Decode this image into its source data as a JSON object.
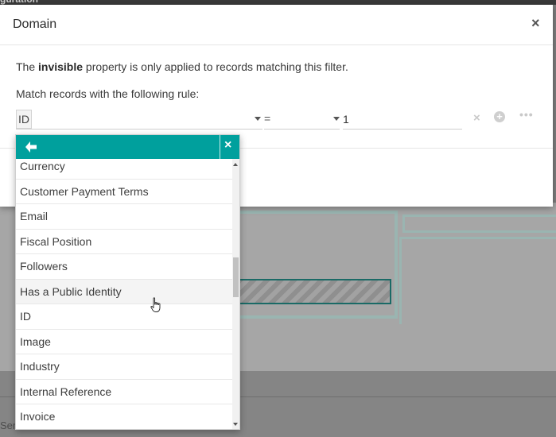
{
  "modal": {
    "title": "Domain",
    "close_symbol": "×",
    "info": {
      "before": "The ",
      "property": "invisible",
      "after": " property is only applied to records matching this filter."
    },
    "rule_label": "Match records with the following rule:"
  },
  "rule": {
    "field": "ID",
    "operator": "=",
    "value": "1",
    "delete_symbol": "×",
    "add_symbol": "+",
    "more_symbol": "•••"
  },
  "field_selector": {
    "close_symbol": "×",
    "items": [
      "Currency",
      "Customer Payment Terms",
      "Email",
      "Fiscal Position",
      "Followers",
      "Has a Public Identity",
      "ID",
      "Image",
      "Industry",
      "Internal Reference",
      "Invoice"
    ],
    "hovered_index": 5
  },
  "background": {
    "top_text": "guration",
    "lower_text": "Sen"
  },
  "colors": {
    "accent": "#00a09d"
  }
}
